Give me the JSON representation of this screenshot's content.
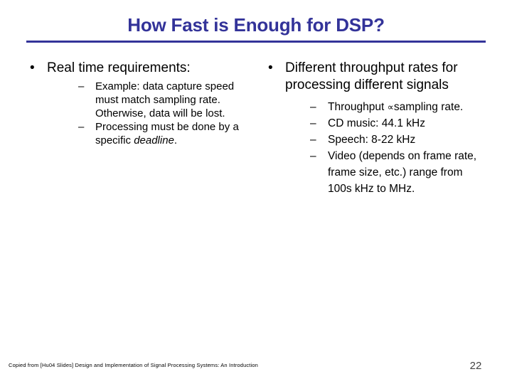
{
  "slide": {
    "title": "How Fast is Enough for DSP?",
    "title_color": "#333399",
    "background_color": "#ffffff",
    "body_text_color": "#000000",
    "page_number": "22",
    "footer": "Copied from  [Hu04 Slides] Design and Implementation of Signal Processing Systems: An Introduction"
  },
  "left_column": {
    "bullet_glyph": "•",
    "dash_glyph": "–",
    "heading": "Real time requirements:",
    "sub_items": [
      {
        "text_before": "Example: data capture speed must match sampling rate. Otherwise, data will be lost.",
        "emphasis": "",
        "text_after": ""
      },
      {
        "text_before": "Processing must be done by a specific ",
        "emphasis": "deadline",
        "text_after": "."
      }
    ]
  },
  "right_column": {
    "bullet_glyph": "•",
    "dash_glyph": "–",
    "heading": "Different throughput rates for processing different signals",
    "sub_items": [
      {
        "text_before": "Throughput ",
        "symbol": "∝",
        "text_after": "sampling rate."
      },
      {
        "text_before": "CD music: 44.1 kHz",
        "symbol": "",
        "text_after": ""
      },
      {
        "text_before": "Speech: 8-22 kHz",
        "symbol": "",
        "text_after": ""
      },
      {
        "text_before": "Video (depends on frame rate, frame size, etc.) range from 100s kHz to MHz.",
        "symbol": "",
        "text_after": ""
      }
    ]
  }
}
